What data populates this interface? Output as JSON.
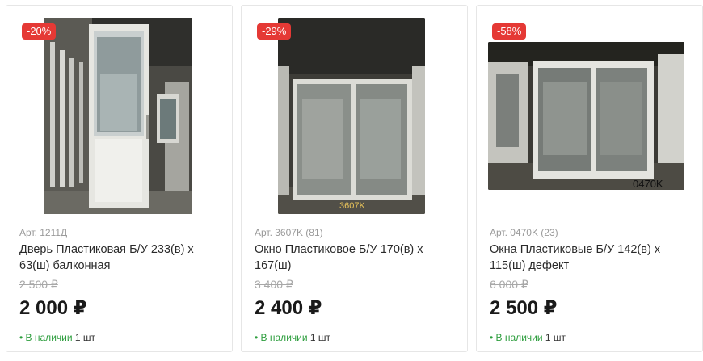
{
  "products": [
    {
      "discount": "-20%",
      "article": "Арт. 1211Д",
      "title": "Дверь Пластиковая Б/У 233(в) х 63(ш) балконная",
      "old_price": "2 500 ₽",
      "price": "2 000 ₽",
      "availability": "В наличии",
      "quantity": "1 шт"
    },
    {
      "discount": "-29%",
      "article": "Арт. 3607K (81)",
      "title": "Окно Пластиковое Б/У 170(в) х 167(ш)",
      "old_price": "3 400 ₽",
      "price": "2 400 ₽",
      "availability": "В наличии",
      "quantity": "1 шт",
      "image_label": "3607K"
    },
    {
      "discount": "-58%",
      "article": "Арт. 0470K (23)",
      "title": "Окна Пластиковые Б/У 142(в) х 115(ш) дефект",
      "old_price": "6 000 ₽",
      "price": "2 500 ₽",
      "availability": "В наличии",
      "quantity": "1 шт",
      "image_label": "0470K"
    }
  ],
  "colors": {
    "badge": "#e53935",
    "stock": "#2e9e3e"
  }
}
